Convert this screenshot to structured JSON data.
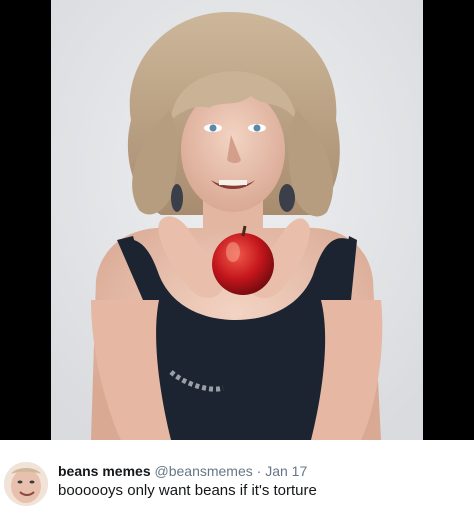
{
  "tweet": {
    "display_name": "beans memes",
    "handle": "@beansmemes",
    "separator": "·",
    "date": "Jan 17",
    "text": "boooooys only want beans if it's torture"
  },
  "colors": {
    "name": "#14171a",
    "meta": "#657786",
    "photo_background": "#e7e8ea",
    "letterbox": "#000000"
  },
  "icons": {
    "avatar": "face-photo",
    "apple": "red-apple"
  }
}
